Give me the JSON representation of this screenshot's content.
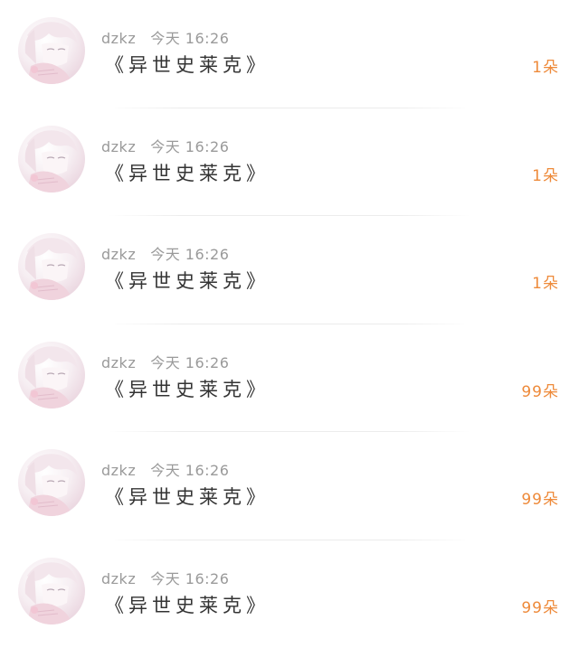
{
  "colors": {
    "accent_amount": "#ee8a3a",
    "meta_text": "#9a9a9a",
    "title_text": "#333333",
    "divider": "#ececec"
  },
  "avatar_icon": "anime-girl-avatar",
  "messages": [
    {
      "username": "dzkz",
      "time": "今天 16:26",
      "title": "《异世史莱克》",
      "amount": "1朵"
    },
    {
      "username": "dzkz",
      "time": "今天 16:26",
      "title": "《异世史莱克》",
      "amount": "1朵"
    },
    {
      "username": "dzkz",
      "time": "今天 16:26",
      "title": "《异世史莱克》",
      "amount": "1朵"
    },
    {
      "username": "dzkz",
      "time": "今天 16:26",
      "title": "《异世史莱克》",
      "amount": "99朵"
    },
    {
      "username": "dzkz",
      "time": "今天 16:26",
      "title": "《异世史莱克》",
      "amount": "99朵"
    },
    {
      "username": "dzkz",
      "time": "今天 16:26",
      "title": "《异世史莱克》",
      "amount": "99朵"
    }
  ]
}
